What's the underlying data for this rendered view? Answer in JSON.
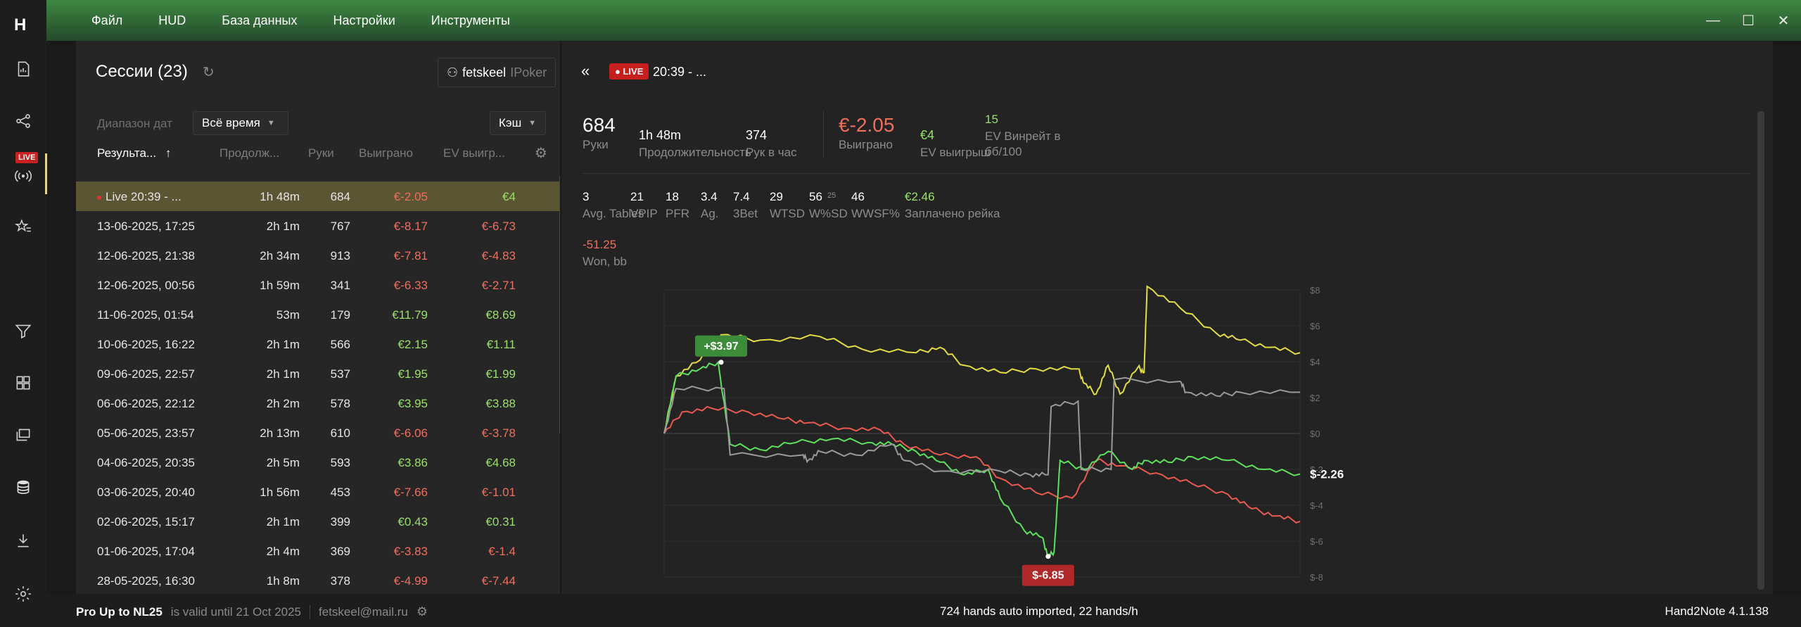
{
  "app": {
    "logo_text": "H",
    "live_badge": "LIVE"
  },
  "menu": [
    "Файл",
    "HUD",
    "База данных",
    "Настройки",
    "Инструменты"
  ],
  "window_controls": {
    "minimize": "—",
    "maximize": "☐",
    "close": "✕"
  },
  "sessions": {
    "title": "Сессии (23)",
    "player_name": "fetskeel",
    "player_site": "IPoker",
    "date_range_label": "Диапазон дат",
    "date_range_value": "Всё время",
    "game_type_value": "Кэш",
    "columns": [
      "Результа...",
      "Продолж...",
      "Руки",
      "Выиграно",
      "EV выигр..."
    ],
    "sort_icon": "↑",
    "rows": [
      {
        "name": "Live 20:39 - ...",
        "duration": "1h 48m",
        "hands": "684",
        "won": "€-2.05",
        "ev": "€4",
        "live": true
      },
      {
        "name": "13-06-2025, 17:25",
        "duration": "2h 1m",
        "hands": "767",
        "won": "€-8.17",
        "ev": "€-6.73"
      },
      {
        "name": "12-06-2025, 21:38",
        "duration": "2h 34m",
        "hands": "913",
        "won": "€-7.81",
        "ev": "€-4.83"
      },
      {
        "name": "12-06-2025, 00:56",
        "duration": "1h 59m",
        "hands": "341",
        "won": "€-6.33",
        "ev": "€-2.71"
      },
      {
        "name": "11-06-2025, 01:54",
        "duration": "53m",
        "hands": "179",
        "won": "€11.79",
        "ev": "€8.69"
      },
      {
        "name": "10-06-2025, 16:22",
        "duration": "2h 1m",
        "hands": "566",
        "won": "€2.15",
        "ev": "€1.11"
      },
      {
        "name": "09-06-2025, 22:57",
        "duration": "2h 1m",
        "hands": "537",
        "won": "€1.95",
        "ev": "€1.99"
      },
      {
        "name": "06-06-2025, 22:12",
        "duration": "2h 2m",
        "hands": "578",
        "won": "€3.95",
        "ev": "€3.88"
      },
      {
        "name": "05-06-2025, 23:57",
        "duration": "2h 13m",
        "hands": "610",
        "won": "€-6.06",
        "ev": "€-3.78"
      },
      {
        "name": "04-06-2025, 20:35",
        "duration": "2h 5m",
        "hands": "593",
        "won": "€3.86",
        "ev": "€4.68"
      },
      {
        "name": "03-06-2025, 20:40",
        "duration": "1h 56m",
        "hands": "453",
        "won": "€-7.66",
        "ev": "€-1.01"
      },
      {
        "name": "02-06-2025, 15:17",
        "duration": "2h 1m",
        "hands": "399",
        "won": "€0.43",
        "ev": "€0.31"
      },
      {
        "name": "01-06-2025, 17:04",
        "duration": "2h 4m",
        "hands": "369",
        "won": "€-3.83",
        "ev": "€-1.4"
      },
      {
        "name": "28-05-2025, 16:30",
        "duration": "1h 8m",
        "hands": "378",
        "won": "€-4.99",
        "ev": "€-7.44"
      }
    ]
  },
  "session_detail": {
    "collapse_icon": "«",
    "live_tag": "● LIVE",
    "title": "20:39 - ...",
    "stats_top": {
      "hands_value": "684",
      "hands_label": "Руки",
      "duration_value": "1h 48m",
      "duration_label": "Продолжительность",
      "hph_value": "374",
      "hph_label": "Рук в час",
      "won_value": "€-2.05",
      "won_label": "Выиграно",
      "ev_value": "€4",
      "ev_label": "EV выигрыш",
      "evbb_value": "15",
      "evbb_label_1": "EV Винрейт в",
      "evbb_label_2": "бб/100"
    },
    "stats_row2": [
      {
        "value": "3",
        "label": "Avg. Tables"
      },
      {
        "value": "21",
        "label": "VPIP"
      },
      {
        "value": "18",
        "label": "PFR"
      },
      {
        "value": "3.4",
        "label": "Ag."
      },
      {
        "value": "7.4",
        "label": "3Bet"
      },
      {
        "value": "29",
        "label": "WTSD"
      },
      {
        "value": "56",
        "label": "W%SD",
        "sup": "25"
      },
      {
        "value": "46",
        "label": "WWSF%"
      },
      {
        "value": "€2.46",
        "label": "Заплачено рейка"
      }
    ],
    "won_bb_value": "-51.25",
    "won_bb_label": "Won, bb"
  },
  "chart_data": {
    "type": "line",
    "y_ticks": [
      "$8",
      "$6",
      "$4",
      "$2",
      "$0",
      "$-2",
      "$-4",
      "$-6",
      "$-8"
    ],
    "ylim": [
      -8,
      8
    ],
    "xlim": [
      0,
      684
    ],
    "grid": true,
    "annotations": [
      {
        "text": "+$3.97",
        "x": 95,
        "y": 3.97,
        "color": "#3d8c3a"
      },
      {
        "text": "$-6.85",
        "x": 640,
        "y": -6.85,
        "color": "#b02828"
      }
    ],
    "end_label": "$-2.26",
    "series": [
      {
        "color": "#e2dd45",
        "points": [
          [
            0,
            0
          ],
          [
            20,
            3.2
          ],
          [
            60,
            4.1
          ],
          [
            95,
            5.5
          ],
          [
            160,
            5.2
          ],
          [
            260,
            5.4
          ],
          [
            330,
            4.7
          ],
          [
            420,
            4.5
          ],
          [
            460,
            4.8
          ],
          [
            500,
            3.8
          ],
          [
            560,
            3.4
          ],
          [
            620,
            3.6
          ],
          [
            690,
            3.6
          ],
          [
            700,
            2.8
          ],
          [
            720,
            2.2
          ],
          [
            740,
            3.8
          ],
          [
            760,
            2.2
          ],
          [
            790,
            3.7
          ],
          [
            800,
            3.4
          ],
          [
            805,
            8.2
          ],
          [
            860,
            7.0
          ],
          [
            920,
            5.6
          ],
          [
            960,
            5.2
          ],
          [
            1010,
            4.8
          ],
          [
            1060,
            4.5
          ]
        ]
      },
      {
        "color": "#e85a4f",
        "points": [
          [
            0,
            0
          ],
          [
            30,
            1.2
          ],
          [
            80,
            1.4
          ],
          [
            140,
            1.2
          ],
          [
            200,
            0.8
          ],
          [
            240,
            0.6
          ],
          [
            300,
            0.3
          ],
          [
            360,
            0.2
          ],
          [
            400,
            -0.6
          ],
          [
            460,
            -1.2
          ],
          [
            520,
            -1.3
          ],
          [
            560,
            -2.5
          ],
          [
            620,
            -3.3
          ],
          [
            680,
            -3.6
          ],
          [
            720,
            -1.5
          ],
          [
            760,
            -1.8
          ],
          [
            820,
            -2.2
          ],
          [
            880,
            -2.8
          ],
          [
            940,
            -3.4
          ],
          [
            980,
            -4.2
          ],
          [
            1020,
            -4.6
          ],
          [
            1060,
            -4.9
          ]
        ]
      },
      {
        "color": "#5ee05e",
        "points": [
          [
            0,
            0
          ],
          [
            20,
            3.2
          ],
          [
            60,
            3.6
          ],
          [
            90,
            3.97
          ],
          [
            110,
            -0.6
          ],
          [
            160,
            -0.9
          ],
          [
            220,
            -0.5
          ],
          [
            280,
            -0.3
          ],
          [
            340,
            -0.5
          ],
          [
            380,
            -0.6
          ],
          [
            420,
            -1.0
          ],
          [
            460,
            -1.6
          ],
          [
            500,
            -2.3
          ],
          [
            540,
            -2.0
          ],
          [
            560,
            -3.6
          ],
          [
            600,
            -5.4
          ],
          [
            630,
            -5.8
          ],
          [
            640,
            -6.85
          ],
          [
            650,
            -6.6
          ],
          [
            660,
            -1.5
          ],
          [
            700,
            -2.0
          ],
          [
            740,
            -1.0
          ],
          [
            780,
            -2.0
          ],
          [
            800,
            -1.5
          ],
          [
            840,
            -1.6
          ],
          [
            880,
            -1.3
          ],
          [
            940,
            -1.5
          ],
          [
            1000,
            -2.0
          ],
          [
            1060,
            -2.26
          ]
        ]
      },
      {
        "color": "#9a9a9a",
        "points": [
          [
            0,
            0
          ],
          [
            20,
            2.5
          ],
          [
            100,
            2.5
          ],
          [
            110,
            -1.2
          ],
          [
            230,
            -1.2
          ],
          [
            240,
            -1.5
          ],
          [
            260,
            -1.0
          ],
          [
            320,
            -1.2
          ],
          [
            380,
            -0.6
          ],
          [
            400,
            -1.5
          ],
          [
            460,
            -2.1
          ],
          [
            560,
            -2.1
          ],
          [
            610,
            -2.3
          ],
          [
            640,
            -2.3
          ],
          [
            645,
            1.5
          ],
          [
            690,
            1.8
          ],
          [
            695,
            -2.0
          ],
          [
            745,
            -2.0
          ],
          [
            750,
            3.0
          ],
          [
            860,
            2.9
          ],
          [
            870,
            2.3
          ],
          [
            920,
            2.1
          ],
          [
            960,
            2.3
          ],
          [
            1060,
            2.3
          ]
        ]
      }
    ]
  },
  "status": {
    "plan": "Pro Up to NL25",
    "valid": "is valid until 21 Oct 2025",
    "email": "fetskeel@mail.ru",
    "import": "724 hands auto imported, 22 hands/h",
    "version": "Hand2Note 4.1.138"
  }
}
